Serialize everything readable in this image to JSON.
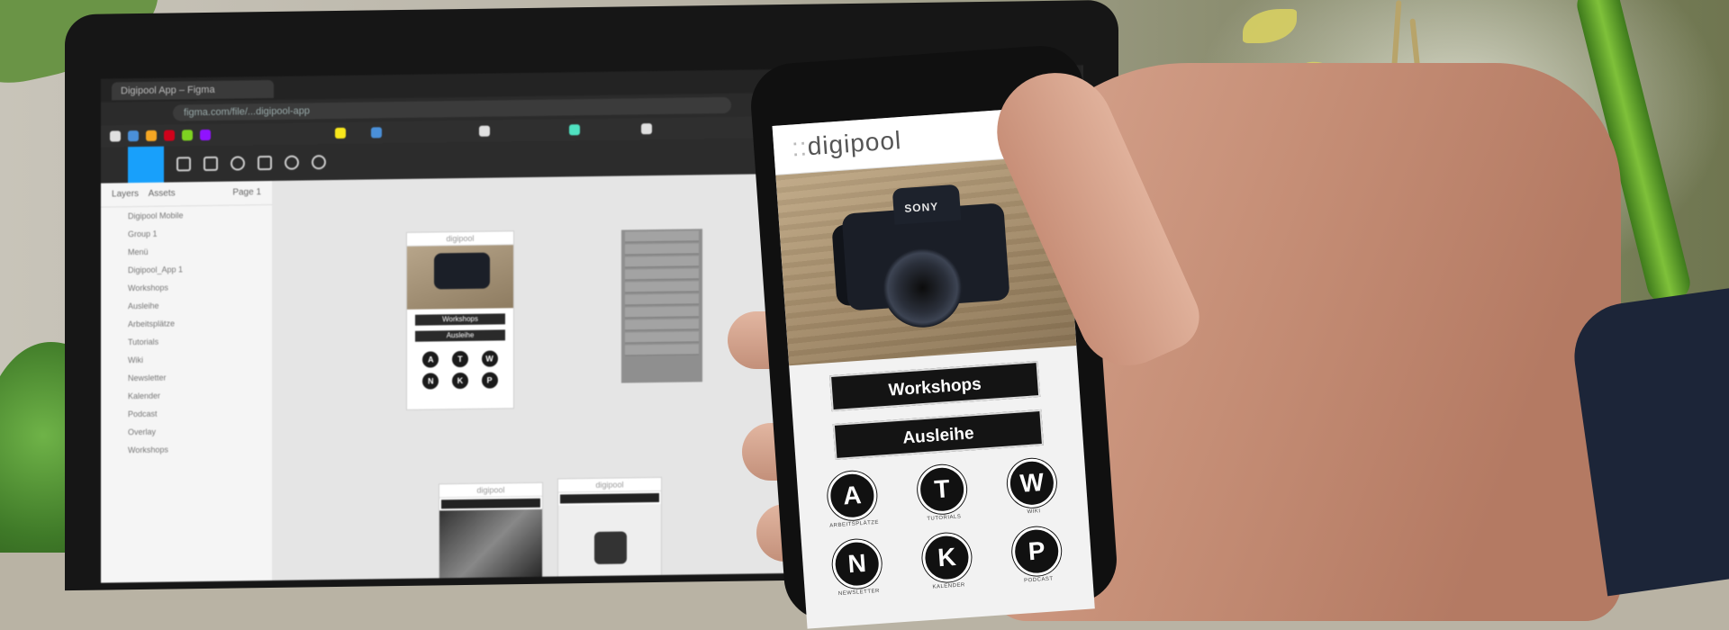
{
  "browser": {
    "tab_title": "Digipool App – Figma",
    "url": "figma.com/file/...digipool-app"
  },
  "figma": {
    "layers_tab": "Layers",
    "assets_tab": "Assets",
    "page_label": "Page 1",
    "layers": [
      "Digipool Mobile",
      "Group 1",
      "Menü",
      "Digipool_App 1",
      "Workshops",
      "Ausleihe",
      "Arbeitsplätze",
      "Tutorials",
      "Wiki",
      "Newsletter",
      "Kalender",
      "Podcast",
      "Overlay",
      "Workshops"
    ],
    "mini_frame_logo": "digipool",
    "mini_btn_workshops": "Workshops",
    "mini_btn_ausleihe": "Ausleihe",
    "mini_letters": [
      "A",
      "T",
      "W",
      "N",
      "K",
      "P"
    ]
  },
  "phone_app": {
    "logo_dots": "::",
    "logo_text": "digipool",
    "camera_brand": "SONY",
    "btn_workshops": "Workshops",
    "btn_ausleihe": "Ausleihe",
    "icons": [
      {
        "letter": "A",
        "caption": "ARBEITSPLÄTZE"
      },
      {
        "letter": "T",
        "caption": "TUTORIALS"
      },
      {
        "letter": "W",
        "caption": "WIKI"
      },
      {
        "letter": "N",
        "caption": "NEWSLETTER"
      },
      {
        "letter": "K",
        "caption": "KALENDER"
      },
      {
        "letter": "P",
        "caption": "PODCAST"
      }
    ]
  },
  "colors": {
    "figma_accent": "#18a0fb",
    "button_dark": "#141414"
  }
}
